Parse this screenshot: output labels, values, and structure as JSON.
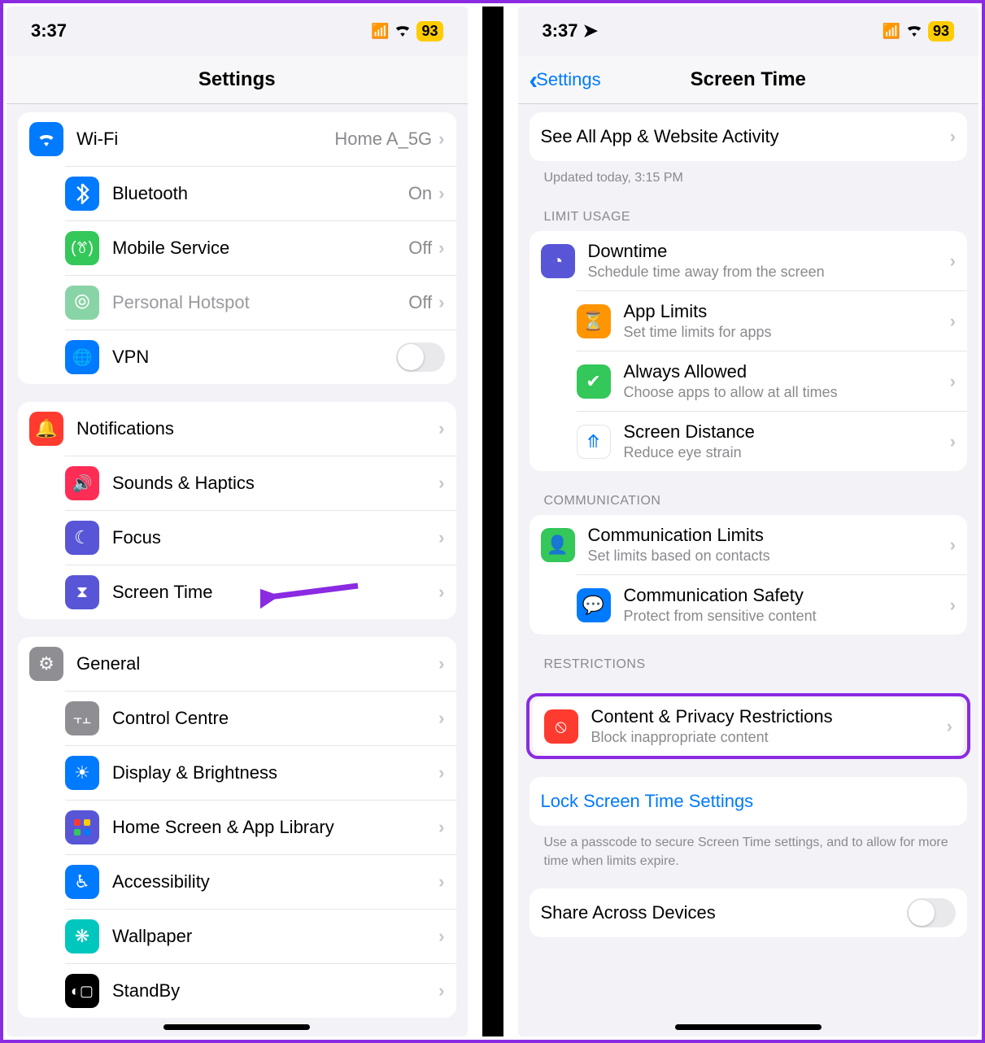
{
  "status": {
    "time": "3:37",
    "battery": "93"
  },
  "left": {
    "title": "Settings",
    "groups": [
      {
        "type": "list",
        "first": true,
        "rows": [
          {
            "icon": "wifi",
            "bg": "#007aff",
            "label": "Wi-Fi",
            "value": "Home A_5G",
            "chevron": true
          },
          {
            "icon": "bluetooth",
            "bg": "#007aff",
            "label": "Bluetooth",
            "value": "On",
            "chevron": true
          },
          {
            "icon": "antenna",
            "bg": "#34c759",
            "label": "Mobile Service",
            "value": "Off",
            "chevron": true
          },
          {
            "icon": "hotspot",
            "bg": "#89d4a6",
            "label": "Personal Hotspot",
            "value": "Off",
            "chevron": true,
            "disabled": true
          },
          {
            "icon": "vpn",
            "bg": "#007aff",
            "label": "VPN",
            "toggle": true
          }
        ]
      },
      {
        "type": "list",
        "rows": [
          {
            "icon": "bell",
            "bg": "#ff3b30",
            "label": "Notifications",
            "chevron": true
          },
          {
            "icon": "sound",
            "bg": "#ff2d55",
            "label": "Sounds & Haptics",
            "chevron": true
          },
          {
            "icon": "moon",
            "bg": "#5856d6",
            "label": "Focus",
            "chevron": true
          },
          {
            "icon": "hourglass",
            "bg": "#5856d6",
            "label": "Screen Time",
            "chevron": true,
            "arrow": true
          }
        ]
      },
      {
        "type": "list",
        "rows": [
          {
            "icon": "gear",
            "bg": "#8e8e93",
            "label": "General",
            "chevron": true
          },
          {
            "icon": "toggles",
            "bg": "#8e8e93",
            "label": "Control Centre",
            "chevron": true
          },
          {
            "icon": "brightness",
            "bg": "#007aff",
            "label": "Display & Brightness",
            "chevron": true
          },
          {
            "icon": "apps",
            "bg": "#5856d6",
            "label": "Home Screen & App Library",
            "chevron": true
          },
          {
            "icon": "accessibility",
            "bg": "#007aff",
            "label": "Accessibility",
            "chevron": true
          },
          {
            "icon": "wallpaper",
            "bg": "#00c7be",
            "label": "Wallpaper",
            "chevron": true
          },
          {
            "icon": "standby",
            "bg": "#000",
            "label": "StandBy",
            "chevron": true
          }
        ]
      }
    ]
  },
  "right": {
    "back": "Settings",
    "title": "Screen Time",
    "activity": {
      "label": "See All App & Website Activity",
      "updated": "Updated today, 3:15 PM"
    },
    "sections": [
      {
        "header": "LIMIT USAGE",
        "rows": [
          {
            "icon": "downtime",
            "bg": "#5856d6",
            "title": "Downtime",
            "sub": "Schedule time away from the screen"
          },
          {
            "icon": "timer",
            "bg": "#ff9500",
            "title": "App Limits",
            "sub": "Set time limits for apps"
          },
          {
            "icon": "check",
            "bg": "#34c759",
            "title": "Always Allowed",
            "sub": "Choose apps to allow at all times"
          },
          {
            "icon": "distance",
            "bg": "#fff",
            "mono": true,
            "title": "Screen Distance",
            "sub": "Reduce eye strain"
          }
        ]
      },
      {
        "header": "COMMUNICATION",
        "rows": [
          {
            "icon": "contact",
            "bg": "#34c759",
            "title": "Communication Limits",
            "sub": "Set limits based on contacts"
          },
          {
            "icon": "safety",
            "bg": "#007aff",
            "title": "Communication Safety",
            "sub": "Protect from sensitive content"
          }
        ]
      },
      {
        "header": "RESTRICTIONS",
        "highlight": true,
        "rows": [
          {
            "icon": "restrict",
            "bg": "#ff3b30",
            "title": "Content & Privacy Restrictions",
            "sub": "Block inappropriate content"
          }
        ]
      }
    ],
    "lock": {
      "link": "Lock Screen Time Settings",
      "footer": "Use a passcode to secure Screen Time settings, and to allow for more time when limits expire."
    },
    "share": {
      "label": "Share Across Devices"
    }
  }
}
